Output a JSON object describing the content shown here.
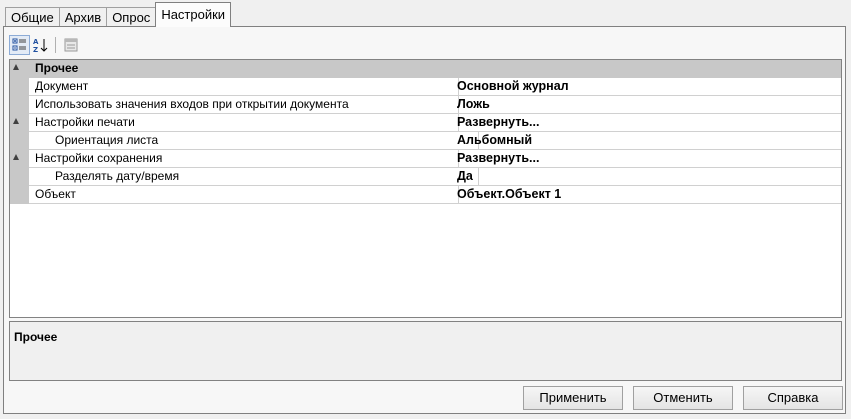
{
  "tabs": [
    {
      "label": "Общие",
      "active": false
    },
    {
      "label": "Архив",
      "active": false
    },
    {
      "label": "Опрос",
      "active": false
    },
    {
      "label": "Настройки",
      "active": true
    }
  ],
  "toolbar": {
    "buttons": [
      "categorized-view-icon",
      "alphabetical-sort-icon",
      "property-pages-icon"
    ]
  },
  "grid": {
    "category": "Прочее",
    "rows": [
      {
        "name": "Документ",
        "value": "Основной журнал"
      },
      {
        "name": "Использовать значения входов при открытии документа",
        "value": "Ложь"
      },
      {
        "name": "Настройки печати",
        "value": "Развернуть..."
      },
      {
        "name": "Ориентация листа",
        "value": "Альбомный"
      },
      {
        "name": "Настройки сохранения",
        "value": "Развернуть..."
      },
      {
        "name": "Разделять дату/время",
        "value": "Да"
      },
      {
        "name": "Объект",
        "value": "Объект.Объект 1"
      }
    ]
  },
  "description": {
    "title": "Прочее"
  },
  "buttons": {
    "apply": "Применить",
    "cancel": "Отменить",
    "help": "Справка"
  },
  "colors": {
    "category_bg": "#c8c8c8",
    "grid_bg": "#ffffff",
    "window_bg": "#f0f0f0"
  }
}
